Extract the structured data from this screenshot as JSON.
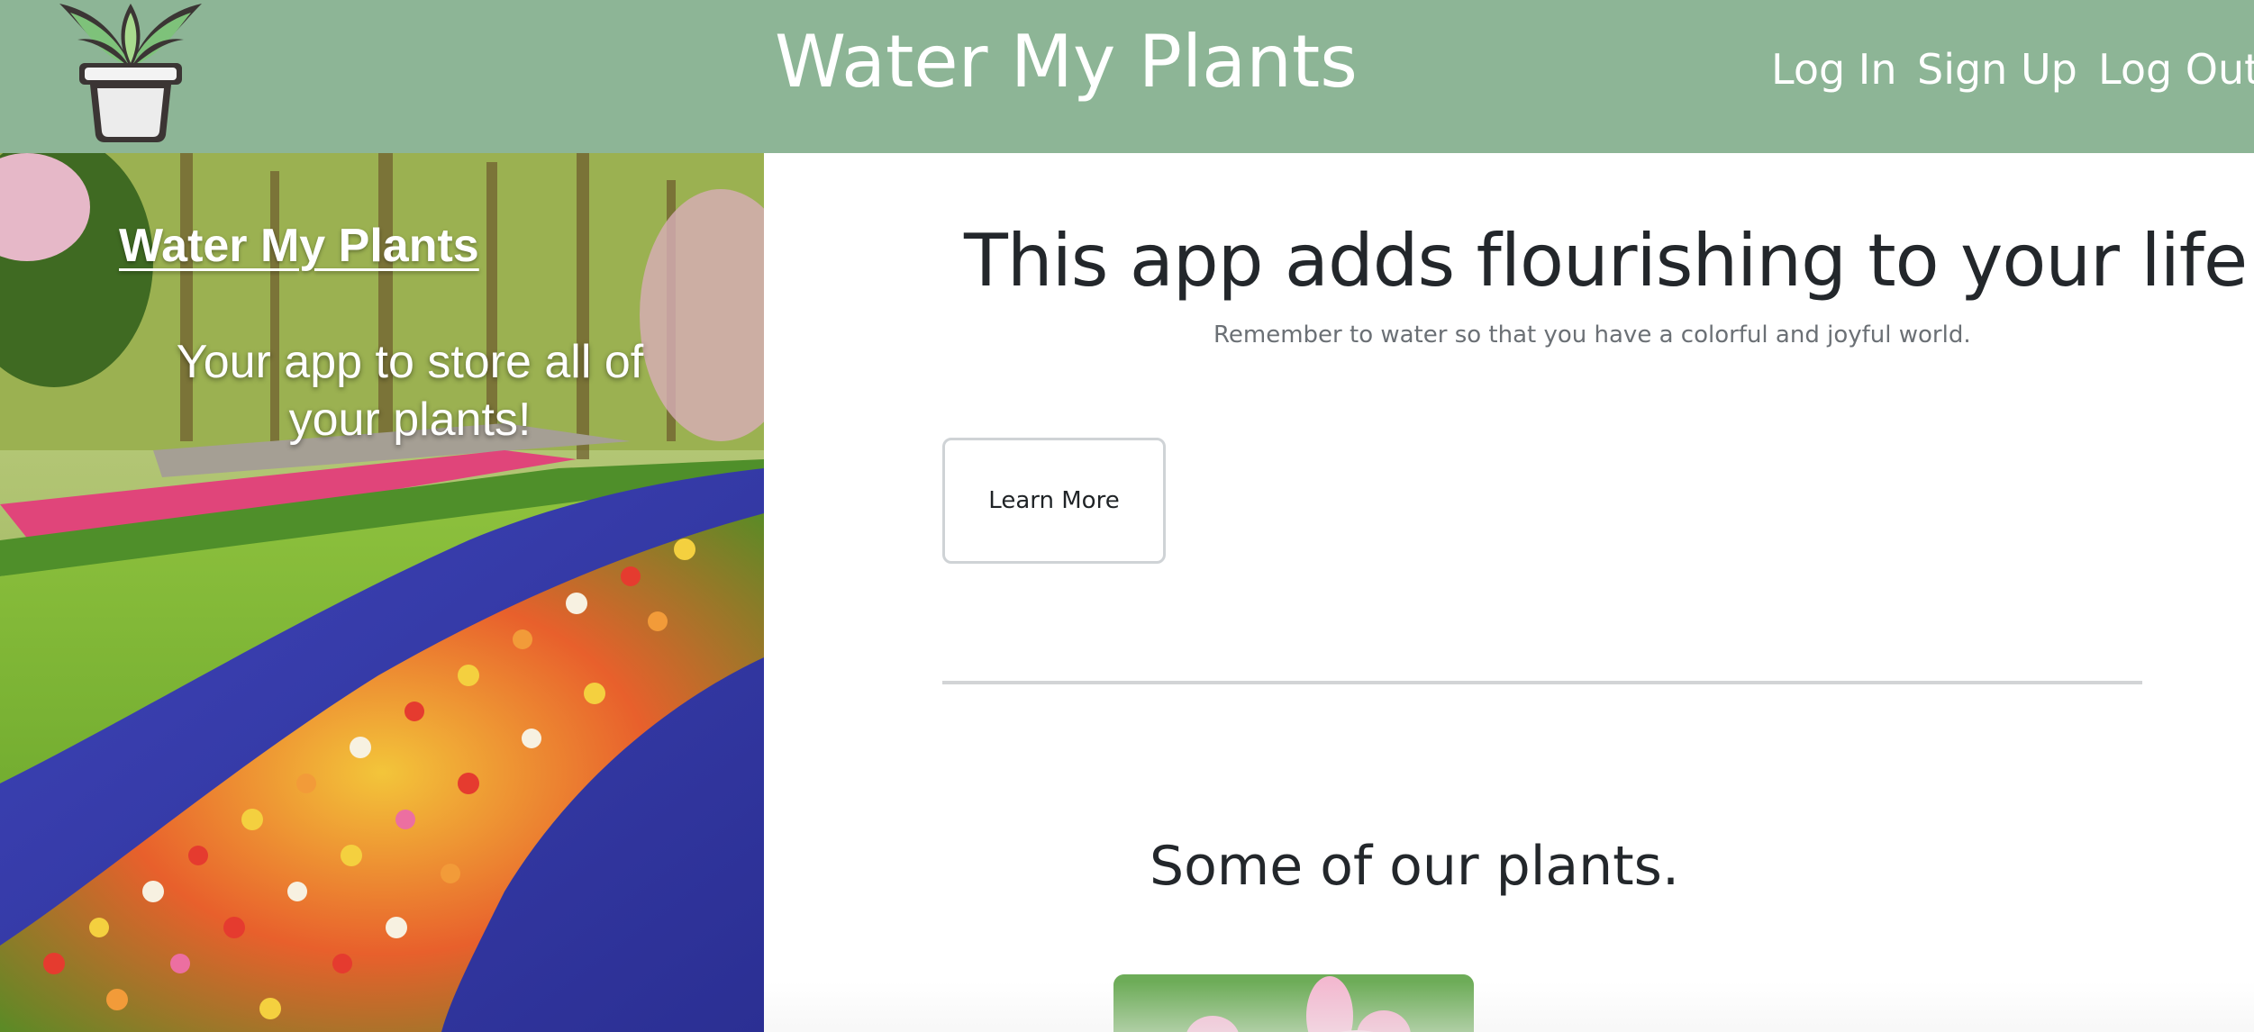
{
  "header": {
    "title": "Water My Plants",
    "logo_icon": "potted-plant-icon",
    "nav": {
      "login_label": "Log In",
      "signup_label": "Sign Up",
      "logout_label": "Log Out"
    },
    "background_color": "#8db596"
  },
  "hero": {
    "title": "Water My Plants",
    "tagline": "Your app to store all of your plants!"
  },
  "main": {
    "heading": "This app adds flourishing to your life.",
    "subheading": "Remember to water so that you have a colorful and joyful world.",
    "learn_more_label": "Learn More",
    "plants_heading": "Some of our plants."
  }
}
